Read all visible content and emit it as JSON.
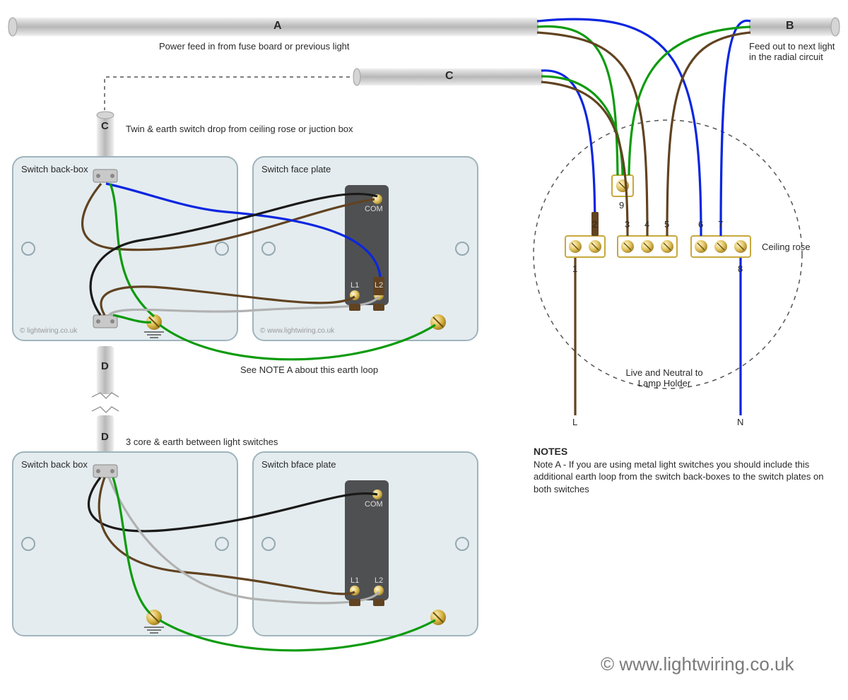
{
  "cables": {
    "a_letter": "A",
    "a_desc": "Power feed in from fuse board or previous light",
    "b_letter": "B",
    "b_desc": "Feed out to next light in the radial circuit",
    "c_letter": "C",
    "c_letter2": "C",
    "c_desc": "Twin & earth switch drop from ceiling rose or juction box",
    "d_letter": "D",
    "d_letter2": "D",
    "d_desc": "3 core & earth between light switches"
  },
  "switch1": {
    "backbox_label": "Switch back-box",
    "faceplate_label": "Switch face plate",
    "com": "COM",
    "l1": "L1",
    "l2": "L2",
    "earth_note": "See NOTE A about this earth loop",
    "copyright_back": "© lightwiring.co.uk",
    "copyright_face": "© www.lightwiring.co.uk"
  },
  "switch2": {
    "backbox_label": "Switch back box",
    "faceplate_label": "Switch bface plate",
    "com": "COM",
    "l1": "L1",
    "l2": "L2"
  },
  "rose": {
    "label": "Ceiling rose",
    "t1": "1",
    "t2": "2",
    "t3": "3",
    "t4": "4",
    "t5": "5",
    "t6": "6",
    "t7": "7",
    "t8": "8",
    "t9": "9",
    "lamp_note": "Live and Neutral to Lamp Holder",
    "l_label": "L",
    "n_label": "N"
  },
  "notes": {
    "heading": "NOTES",
    "a": "Note A - If you are using metal light switches you should include this additional earth loop from the switch back-boxes to the switch plates on both switches"
  },
  "watermark": "© www.lightwiring.co.uk",
  "colors": {
    "blue": "#0a26e0",
    "green": "#0d9b0d",
    "brown": "#614321",
    "black": "#1b1a19",
    "grey": "#b1b1b1",
    "conduit_light": "#e2e2e2",
    "conduit_dark": "#a0a0a0",
    "box_fill": "#e4ecef",
    "box_stroke": "#9fb4bc",
    "switch_fill": "#4f5052",
    "brass": "#d9b342"
  }
}
